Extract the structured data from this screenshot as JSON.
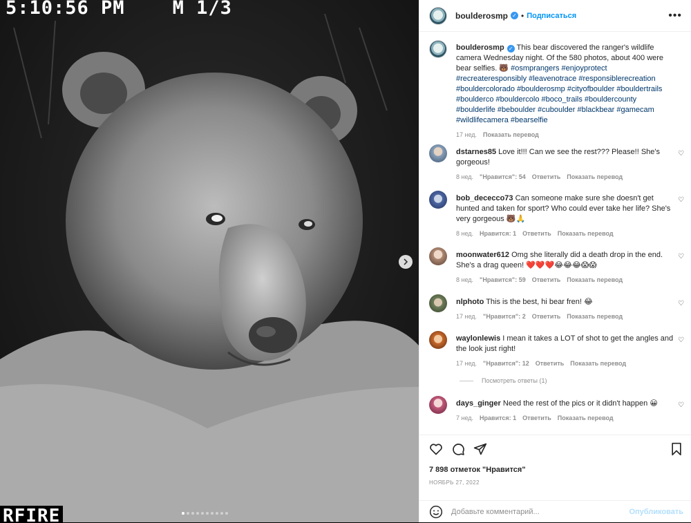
{
  "camera_overlay": {
    "timestamp": "5:10:56 PM",
    "counter": "M 1/3",
    "footer": "RFIRE"
  },
  "carousel": {
    "dots": 10,
    "active_index": 0
  },
  "header": {
    "username": "boulderosmp",
    "follow_label": "Подписаться",
    "more_label": "•••"
  },
  "caption": {
    "username": "boulderosmp",
    "text": "This bear discovered the ranger's wildlife camera Wednesday night. Of the 580 photos, about 400 were bear selfies. 🐻 ",
    "hashtags": "#osmprangers #enjoyprotect #recreateresponsibly #leavenotrace #responsiblerecreation #bouldercolorado #boulderosmp #cityofboulder #bouldertrails #boulderco #bouldercolo #boco_trails #bouldercounty #boulderlife #beboulder #cuboulder #blackbear #gamecam #wildlifecamera #bearselfie",
    "time": "17 нед.",
    "translate": "Показать перевод"
  },
  "comments": [
    {
      "user": "dstarnes85",
      "text": "Love it!!! Can we see the rest??? Please!! She's gorgeous!",
      "time": "8 нед.",
      "likes": "\"Нравится\": 54",
      "reply": "Ответить",
      "translate": "Показать перевод"
    },
    {
      "user": "bob_dececco73",
      "text": "Can someone make sure she doesn't get hunted and taken for sport? Who could ever take her life? She's very gorgeous 🐻🙏",
      "time": "8 нед.",
      "likes": "Нравится: 1",
      "reply": "Ответить",
      "translate": "Показать перевод"
    },
    {
      "user": "moonwater612",
      "text": "Omg she literally did a death drop in the end. She's a drag queen! ❤️❤️❤️😂😂😂😱😱",
      "time": "8 нед.",
      "likes": "\"Нравится\": 59",
      "reply": "Ответить",
      "translate": "Показать перевод"
    },
    {
      "user": "nlphoto",
      "text": "This is the best, hi bear fren! 😂",
      "time": "17 нед.",
      "likes": "\"Нравится\": 2",
      "reply": "Ответить",
      "translate": "Показать перевод"
    },
    {
      "user": "waylonlewis",
      "text": "I mean it takes a LOT of shot to get the angles and the look just right!",
      "time": "17 нед.",
      "likes": "\"Нравится\": 12",
      "reply": "Ответить",
      "translate": "Показать перевод"
    },
    {
      "user": "days_ginger",
      "text": "Need the rest of the pics or it didn't happen 😀",
      "time": "7 нед.",
      "likes": "Нравится: 1",
      "reply": "Ответить",
      "translate": "Показать перевод"
    }
  ],
  "view_replies": "Посмотреть ответы (1)",
  "likes_count": "7 898 отметок \"Нравится\"",
  "post_date": "Ноябрь 27, 2022",
  "add_comment": {
    "placeholder": "Добавьте комментарий...",
    "publish": "Опубликовать"
  },
  "colors": {
    "link": "#00376b",
    "follow": "#0095f6",
    "verified": "#3897f0",
    "muted": "#8e8e8e"
  }
}
